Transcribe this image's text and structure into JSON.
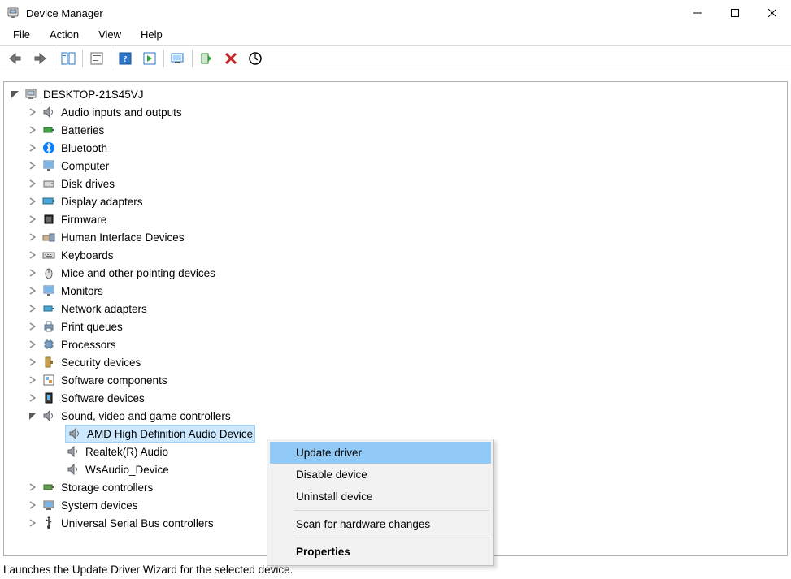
{
  "window": {
    "title": "Device Manager"
  },
  "menu": {
    "file": "File",
    "action": "Action",
    "view": "View",
    "help": "Help"
  },
  "tree": {
    "root": "DESKTOP-21S45VJ",
    "categories": [
      "Audio inputs and outputs",
      "Batteries",
      "Bluetooth",
      "Computer",
      "Disk drives",
      "Display adapters",
      "Firmware",
      "Human Interface Devices",
      "Keyboards",
      "Mice and other pointing devices",
      "Monitors",
      "Network adapters",
      "Print queues",
      "Processors",
      "Security devices",
      "Software components",
      "Software devices",
      "Sound, video and game controllers",
      "Storage controllers",
      "System devices",
      "Universal Serial Bus controllers"
    ],
    "sound_children": [
      "AMD High Definition Audio Device",
      "Realtek(R) Audio",
      "WsAudio_Device"
    ]
  },
  "context_menu": {
    "update": "Update driver",
    "disable": "Disable device",
    "uninstall": "Uninstall device",
    "scan": "Scan for hardware changes",
    "properties": "Properties"
  },
  "status": "Launches the Update Driver Wizard for the selected device."
}
